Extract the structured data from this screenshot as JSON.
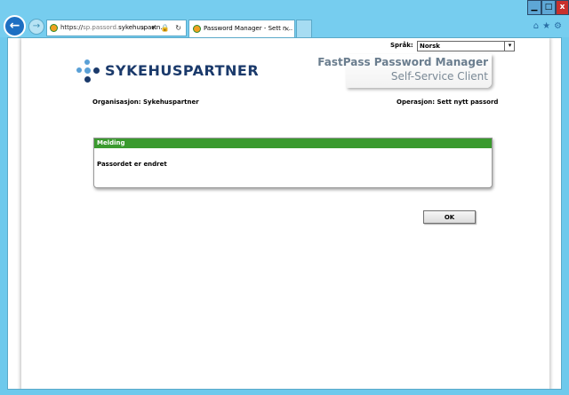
{
  "browser": {
    "url_prefix": "https://",
    "url_grey": "sp.passord.",
    "url_dark": "sykehuspartn...",
    "url_controls": "⌕ ▾ 🔒 ↻",
    "tab_title": "Password Manager - Sett n...",
    "tab_close": "×",
    "win_min": "▁",
    "win_max": "□",
    "win_close": "x",
    "tools": "⌂★⚙"
  },
  "page": {
    "language_label": "Språk:",
    "language_selected": "Norsk",
    "logo_text": "SYKEHUSPARTNER",
    "product_title": "FastPass Password Manager",
    "product_subtitle": "Self-Service Client",
    "organization": "Organisasjon: Sykehuspartner",
    "operation": "Operasjon: Sett nytt passord",
    "message_header": "Melding",
    "message_body": "Passordet er endret",
    "ok_label": "OK"
  },
  "colors": {
    "message_header_bg": "#3a9a2e",
    "logo_text": "#1b3a6b",
    "logo_dot_light": "#5aa0d6",
    "logo_dot_dark": "#1b3a6b"
  }
}
